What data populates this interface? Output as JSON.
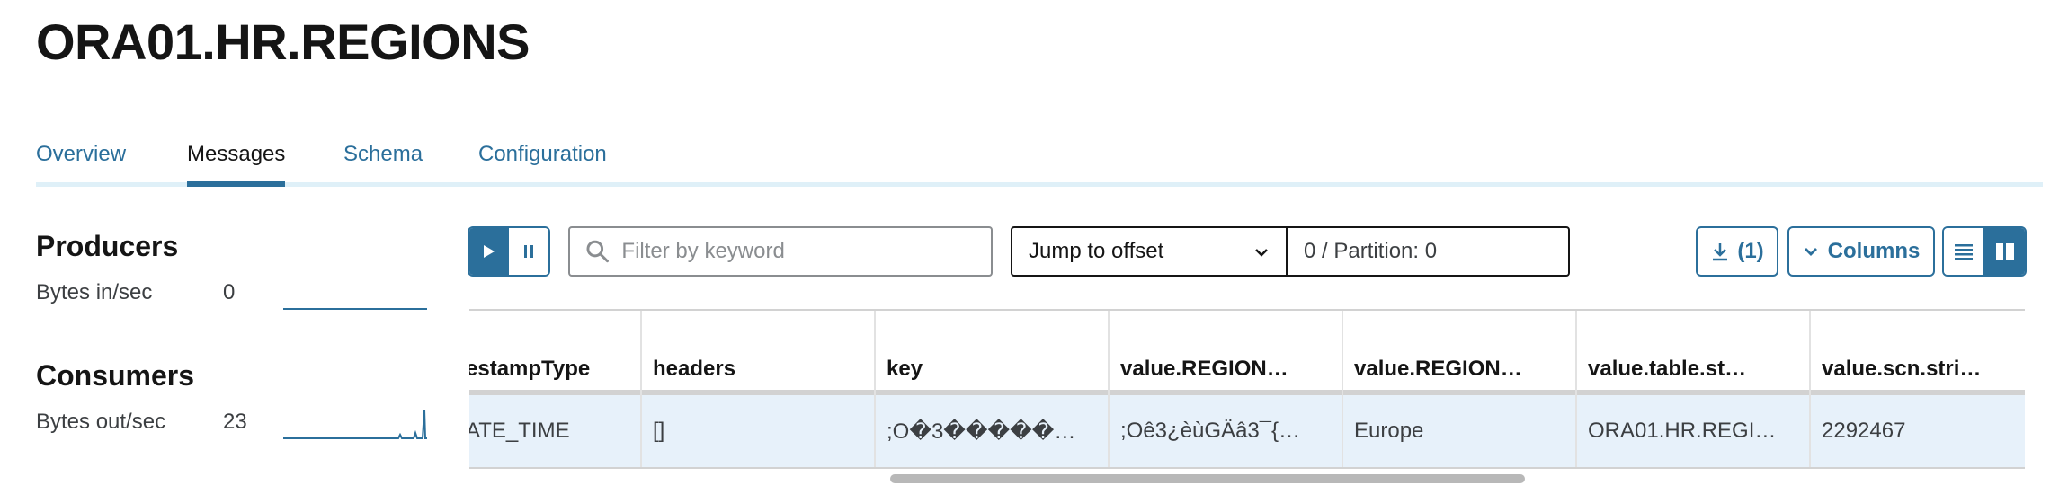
{
  "page": {
    "title": "ORA01.HR.REGIONS"
  },
  "tabs": [
    {
      "label": "Overview",
      "active": false
    },
    {
      "label": "Messages",
      "active": true
    },
    {
      "label": "Schema",
      "active": false
    },
    {
      "label": "Configuration",
      "active": false
    }
  ],
  "producers": {
    "heading": "Producers",
    "metric_label": "Bytes in/sec",
    "metric_value": "0"
  },
  "consumers": {
    "heading": "Consumers",
    "metric_label": "Bytes out/sec",
    "metric_value": "23"
  },
  "toolbar": {
    "play_icon": "play-icon",
    "pause_icon": "pause-icon",
    "filter_placeholder": "Filter by keyword",
    "filter_value": "",
    "offset_mode": "Jump to offset",
    "offset_value": "0 / Partition: 0",
    "download_label": "(1)",
    "columns_label": "Columns",
    "view_mode": "split"
  },
  "table": {
    "columns": [
      "estampType",
      "headers",
      "key",
      "value.REGION…",
      "value.REGION…",
      "value.table.st…",
      "value.scn.stri…"
    ],
    "rows": [
      [
        "ATE_TIME",
        "[]",
        ";O�3�����…",
        ";Oê3¿èùGÄâ3¯{…",
        "Europe",
        "ORA01.HR.REGI…",
        "2292467"
      ]
    ]
  },
  "colors": {
    "accent": "#2b6f9b",
    "row_highlight": "#e7f1fa",
    "tab_underline": "#dff0f8"
  }
}
